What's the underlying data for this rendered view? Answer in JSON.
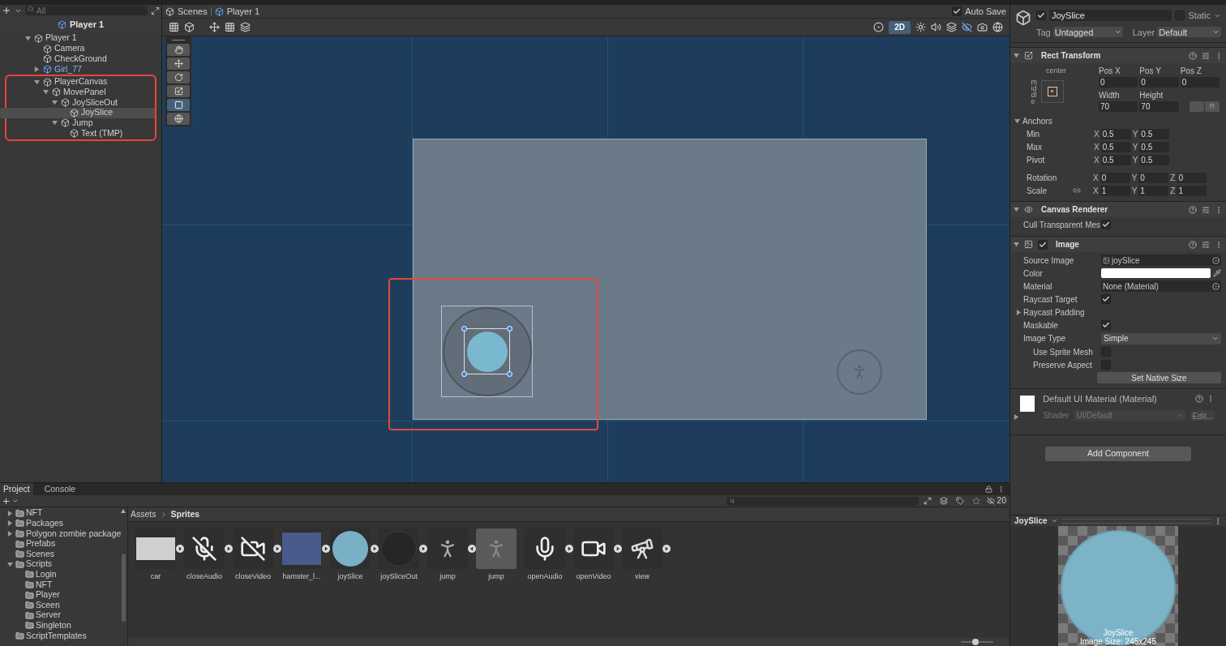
{
  "hierarchy": {
    "search": {
      "placeholder": "All"
    },
    "scene_title": "Player 1",
    "tree": [
      {
        "label": "Player 1",
        "kind": "object",
        "expanded": true,
        "selected": false,
        "children": [
          {
            "label": "Camera",
            "kind": "object",
            "selected": false
          },
          {
            "label": "CheckGround",
            "kind": "object",
            "selected": false
          },
          {
            "label": "Girl_77",
            "kind": "prefab",
            "expanded": false,
            "selected": false
          },
          {
            "label": "PlayerCanvas",
            "kind": "object",
            "expanded": true,
            "selected": false,
            "highlighted": true,
            "children": [
              {
                "label": "MovePanel",
                "kind": "object",
                "expanded": true,
                "selected": false,
                "children": [
                  {
                    "label": "JoySliceOut",
                    "kind": "object",
                    "expanded": true,
                    "selected": false,
                    "children": [
                      {
                        "label": "JoySlice",
                        "kind": "object",
                        "selected": true
                      }
                    ]
                  },
                  {
                    "label": "Jump",
                    "kind": "object",
                    "expanded": true,
                    "selected": false,
                    "children": [
                      {
                        "label": "Text (TMP)",
                        "kind": "object",
                        "selected": false
                      }
                    ]
                  }
                ]
              }
            ]
          }
        ]
      }
    ]
  },
  "scene": {
    "breadcrumb": [
      "Scenes",
      "Player 1"
    ],
    "auto_save": {
      "label": "Auto Save",
      "checked": true
    },
    "toggle_2d": {
      "label": "2D",
      "selected": true
    },
    "tools": [
      {
        "kind": "hand",
        "selected": false
      },
      {
        "kind": "move",
        "selected": false
      },
      {
        "kind": "rotate",
        "selected": false
      },
      {
        "kind": "scale",
        "selected": false
      },
      {
        "kind": "rect",
        "selected": true
      },
      {
        "kind": "transform",
        "selected": false
      }
    ],
    "joystick_highlighted": true
  },
  "inspector": {
    "active": true,
    "name": "JoySlice",
    "static": {
      "label": "Static",
      "checked": false
    },
    "tag": {
      "label": "Tag",
      "value": "Untagged"
    },
    "layer": {
      "label": "Layer",
      "value": "Default"
    },
    "rect_transform": {
      "title": "Rect Transform",
      "anchor_horizontal": "center",
      "anchor_vertical": "middle",
      "pos": [
        {
          "label": "Pos X",
          "value": "0"
        },
        {
          "label": "Pos Y",
          "value": "0"
        },
        {
          "label": "Pos Z",
          "value": "0"
        }
      ],
      "size": [
        {
          "label": "Width",
          "value": "70"
        },
        {
          "label": "Height",
          "value": "70"
        }
      ],
      "raw_button": "R",
      "anchors": {
        "label": "Anchors",
        "expanded": true,
        "rows": [
          {
            "label": "Min",
            "fields": [
              {
                "axis": "X",
                "value": "0.5"
              },
              {
                "axis": "Y",
                "value": "0.5"
              }
            ]
          },
          {
            "label": "Max",
            "fields": [
              {
                "axis": "X",
                "value": "0.5"
              },
              {
                "axis": "Y",
                "value": "0.5"
              }
            ]
          }
        ]
      },
      "rows": [
        {
          "label": "Pivot",
          "fields": [
            {
              "axis": "X",
              "value": "0.5"
            },
            {
              "axis": "Y",
              "value": "0.5"
            }
          ]
        },
        {
          "label": "Rotation",
          "fields": [
            {
              "axis": "X",
              "value": "0"
            },
            {
              "axis": "Y",
              "value": "0"
            },
            {
              "axis": "Z",
              "value": "0"
            }
          ]
        },
        {
          "label": "Scale",
          "linked": true,
          "fields": [
            {
              "axis": "X",
              "value": "1"
            },
            {
              "axis": "Y",
              "value": "1"
            },
            {
              "axis": "Z",
              "value": "1"
            }
          ]
        }
      ]
    },
    "canvas_renderer": {
      "title": "Canvas Renderer",
      "cull": {
        "label": "Cull Transparent Mes",
        "checked": true
      }
    },
    "image": {
      "title": "Image",
      "enabled": true,
      "rows": [
        {
          "label": "Source Image",
          "kind": "object",
          "value": "joySlice"
        },
        {
          "label": "Color",
          "kind": "color",
          "color": "#ffffff"
        },
        {
          "label": "Material",
          "kind": "object",
          "value": "None (Material)"
        },
        {
          "label": "Raycast Target",
          "kind": "check",
          "checked": true
        },
        {
          "label": "Raycast Padding",
          "kind": "foldout",
          "expanded": false
        },
        {
          "label": "Maskable",
          "kind": "check",
          "checked": true
        },
        {
          "label": "Image Type",
          "kind": "dropdown",
          "value": "Simple",
          "children": [
            {
              "label": "Use Sprite Mesh",
              "checked": false
            },
            {
              "label": "Preserve Aspect",
              "checked": false
            }
          ]
        }
      ],
      "button": "Set Native Size"
    },
    "material": {
      "title": "Default UI Material (Material)",
      "expanded": false,
      "shader_label": "Shader",
      "shader": "UI/Default",
      "edit": "Edit..."
    },
    "add_component": "Add Component",
    "preview": {
      "title": "JoySlice",
      "caption": "JoySlice",
      "size": "Image Size: 245x245"
    }
  },
  "project": {
    "tabs": [
      {
        "label": "Project",
        "selected": true
      },
      {
        "label": "Console",
        "selected": false
      }
    ],
    "hidden_count": "20",
    "folders": [
      {
        "label": "NFT",
        "expanded": false
      },
      {
        "label": "Packages",
        "expanded": false
      },
      {
        "label": "Polygon zombie package",
        "expanded": false
      },
      {
        "label": "Prefabs"
      },
      {
        "label": "Scenes"
      },
      {
        "label": "Scripts",
        "expanded": true,
        "children": [
          {
            "label": "Login"
          },
          {
            "label": "NFT"
          },
          {
            "label": "Player"
          },
          {
            "label": "Sceen"
          },
          {
            "label": "Server"
          },
          {
            "label": "Singleton"
          }
        ]
      },
      {
        "label": "ScriptTemplates"
      }
    ],
    "breadcrumb": [
      "Assets",
      "Sprites"
    ],
    "assets": [
      {
        "name": "car",
        "kind": "photo",
        "expanded": false
      },
      {
        "name": "closeAudio",
        "kind": "mic-off",
        "expanded": false
      },
      {
        "name": "closeVideo",
        "kind": "video-off",
        "expanded": false
      },
      {
        "name": "hamster_l...",
        "kind": "photo-blue",
        "expanded": false
      },
      {
        "name": "joySlice",
        "kind": "disc",
        "expanded": false
      },
      {
        "name": "joySliceOut",
        "kind": "empty",
        "expanded": false
      },
      {
        "name": "jump",
        "kind": "jump",
        "expanded": true
      },
      {
        "name": "jump",
        "kind": "sub-jump"
      },
      {
        "name": "openAudio",
        "kind": "mic",
        "expanded": false
      },
      {
        "name": "openVideo",
        "kind": "video",
        "expanded": false
      },
      {
        "name": "view",
        "kind": "telescope",
        "expanded": false
      }
    ],
    "zoom": {
      "level": 0.45
    }
  }
}
